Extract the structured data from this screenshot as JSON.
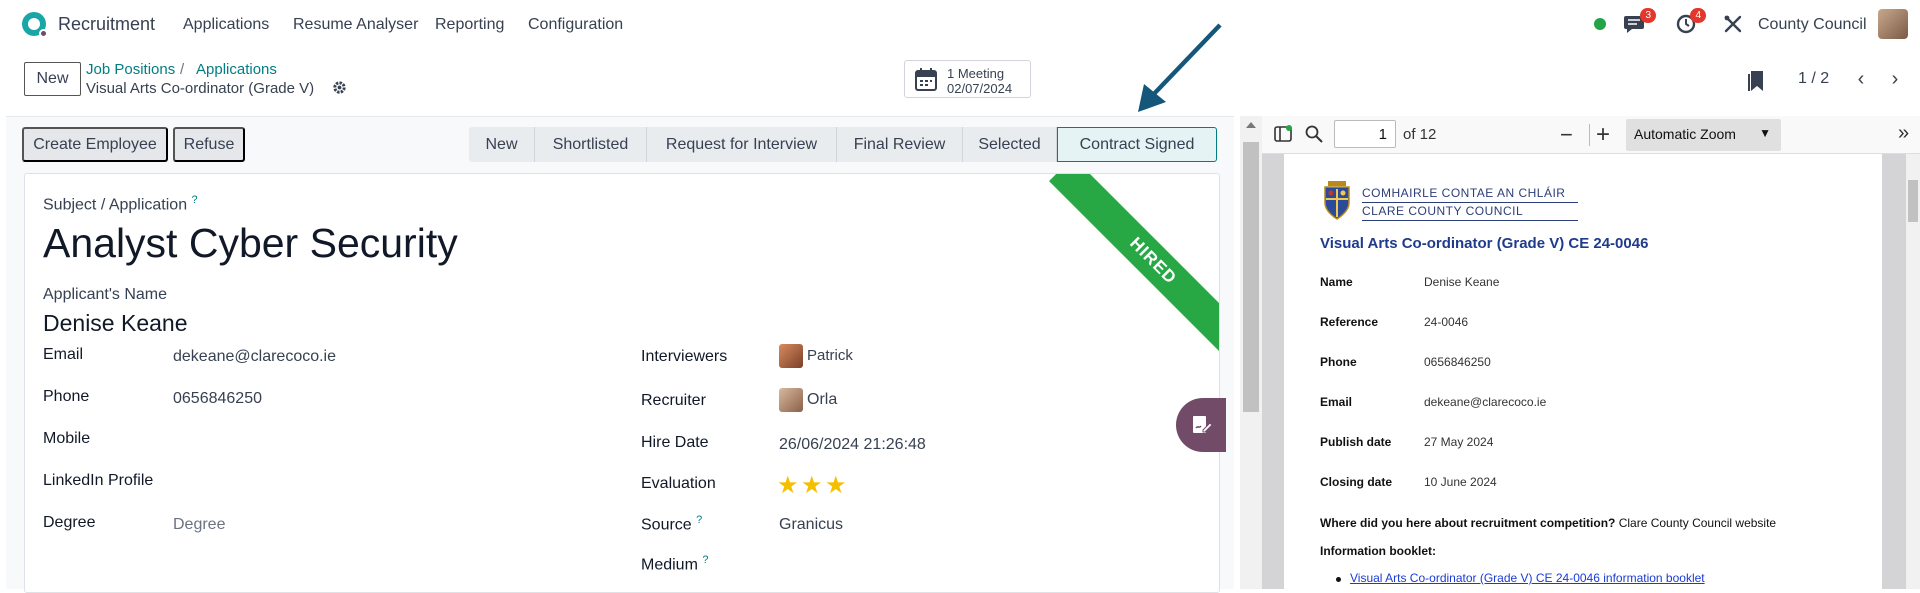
{
  "nav": {
    "app_title": "Recruitment",
    "menus": [
      "Applications",
      "Resume Analyser",
      "Reporting",
      "Configuration"
    ],
    "messages_count": "3",
    "activities_count": "4",
    "company": "County Council"
  },
  "control": {
    "new_label": "New",
    "breadcrumb_1": "Job Positions",
    "breadcrumb_sep": "/",
    "breadcrumb_2": "Applications",
    "record_name": "Visual Arts Co-ordinator (Grade V)",
    "meeting_line1": "1 Meeting",
    "meeting_line2": "02/07/2024",
    "pager": "1 / 2"
  },
  "actions": {
    "create_employee": "Create Employee",
    "refuse": "Refuse"
  },
  "stages": [
    "New",
    "Shortlisted",
    "Request for Interview",
    "Final Review",
    "Selected",
    "Contract Signed"
  ],
  "active_stage": "Contract Signed",
  "form": {
    "ribbon": "HIRED",
    "subject_label": "Subject / Application",
    "subject": "Analyst Cyber Security",
    "applicant_label": "Applicant's Name",
    "applicant": "Denise Keane",
    "email_label": "Email",
    "email": "dekeane@clarecoco.ie",
    "phone_label": "Phone",
    "phone": "0656846250",
    "mobile_label": "Mobile",
    "linkedin_label": "LinkedIn Profile",
    "degree_label": "Degree",
    "degree_placeholder": "Degree",
    "interviewers_label": "Interviewers",
    "interviewer": "Patrick",
    "recruiter_label": "Recruiter",
    "recruiter": "Orla",
    "hire_date_label": "Hire Date",
    "hire_date": "26/06/2024 21:26:48",
    "evaluation_label": "Evaluation",
    "evaluation_stars": 3,
    "source_label": "Source",
    "source": "Granicus",
    "medium_label": "Medium",
    "help_mark": "?"
  },
  "pdf": {
    "page_input": "1",
    "page_total": "of 12",
    "zoom": "Automatic Zoom",
    "org_line1": "COMHAIRLE CONTAE AN CHLÁIR",
    "org_line2": "CLARE COUNTY COUNCIL",
    "doc_title": "Visual Arts Co-ordinator (Grade V) CE 24-0046",
    "fields": [
      {
        "label": "Name",
        "value": "Denise Keane"
      },
      {
        "label": "Reference",
        "value": "24-0046"
      },
      {
        "label": "Phone",
        "value": "0656846250"
      },
      {
        "label": "Email",
        "value": "dekeane@clarecoco.ie"
      },
      {
        "label": "Publish date",
        "value": "27 May 2024"
      },
      {
        "label": "Closing date",
        "value": "10 June 2024"
      }
    ],
    "question": "Where did you here about recruitment competition?",
    "answer": "Clare County Council website",
    "booklet_label": "Information booklet:",
    "booklet_link": "Visual Arts Co-ordinator (Grade V) CE 24-0046 information booklet"
  }
}
